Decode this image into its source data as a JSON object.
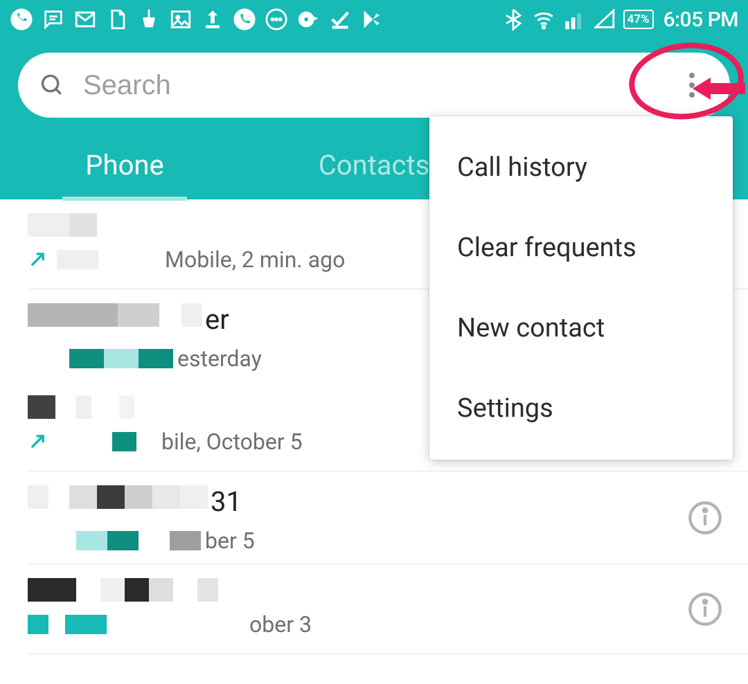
{
  "status": {
    "battery": "47%",
    "clock": "6:05 PM"
  },
  "search": {
    "placeholder": "Search"
  },
  "tabs": {
    "phone": "Phone",
    "contacts": "Contacts"
  },
  "menu": {
    "call_history": "Call history",
    "clear_frequents": "Clear frequents",
    "new_contact": "New contact",
    "settings": "Settings"
  },
  "calls": {
    "row1_suffix": "",
    "row1_info": "Mobile, 2 min. ago",
    "row2_suffix": "er",
    "row2_info": "esterday",
    "row3_suffix": "",
    "row3_info": "bile, October 5",
    "row4_suffix": "31",
    "row4_info": "ber 5",
    "row5_suffix": "",
    "row5_info": "ober 3"
  }
}
